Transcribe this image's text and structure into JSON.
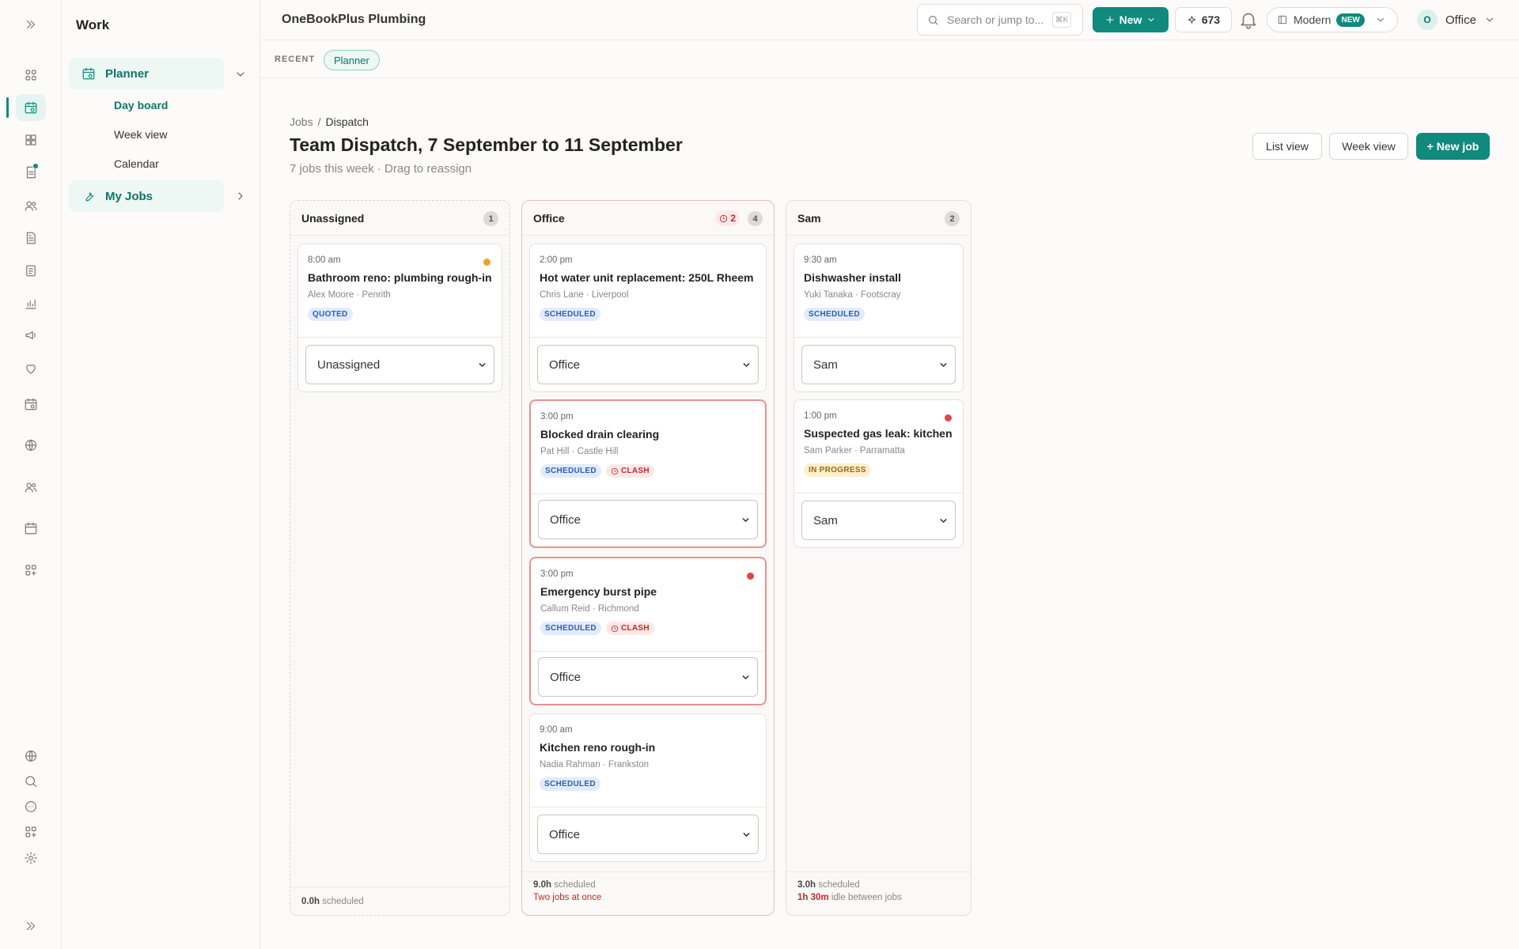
{
  "rail": {
    "items": [
      "expand-icon",
      "dashboard-icon",
      "calendar-icon",
      "grid-icon",
      "document-icon",
      "users-icon",
      "file-icon",
      "clipboard-icon",
      "chart-icon",
      "megaphone-icon",
      "heart-icon",
      "calendar-check-icon",
      "globe-icon",
      "team-icon",
      "calendar-alt-icon",
      "apps-add-icon"
    ],
    "bottom": [
      "globe-icon",
      "search-icon",
      "chat-icon",
      "apps-icon",
      "settings-icon",
      "collapse-icon"
    ]
  },
  "nav": {
    "title": "Work",
    "groups": [
      {
        "label": "Planner",
        "icon": "calendar-icon",
        "expanded": true
      },
      {
        "label": "My Jobs",
        "icon": "wrench-icon",
        "expanded": false
      }
    ],
    "planner_items": [
      "Day board",
      "Week view",
      "Calendar"
    ],
    "active_item": "Day board"
  },
  "topbar": {
    "brand": "OneBookPlus Plumbing",
    "search_placeholder": "Search or jump to...",
    "search_shortcut": "⌘K",
    "new_label": "New",
    "credits": "673",
    "theme_label": "Modern",
    "theme_badge": "NEW",
    "user_initial": "O",
    "user_label": "Office"
  },
  "recent": {
    "label": "RECENT",
    "chip": "Planner"
  },
  "page": {
    "breadcrumb": [
      "Jobs",
      "Dispatch"
    ],
    "title": "Team Dispatch, 7 September to 11 September",
    "subtitle": "7 jobs this week · Drag to reassign",
    "buttons": [
      "List view",
      "Week view",
      "+ New job"
    ]
  },
  "colors": {
    "accent": "#0f8a7c",
    "clash": "#c62828",
    "dot_orange": "#f0a024",
    "dot_red": "#e04545"
  },
  "columns": [
    {
      "name": "Unassigned",
      "count": "1",
      "foot_hours": "0.0h",
      "foot_suffix": "scheduled",
      "cards": [
        {
          "time": "8:00 am",
          "title": "Bathroom reno: plumbing rough-in",
          "meta": "Alex Moore · Penrith",
          "tags": [
            "QUOTED"
          ],
          "assignee": "Unassigned",
          "dot": "orange"
        }
      ]
    },
    {
      "name": "Office",
      "count": "4",
      "clash_count": "2",
      "foot_hours": "9.0h",
      "foot_suffix": "scheduled",
      "foot_alert": "Two jobs at once",
      "cards": [
        {
          "time": "2:00 pm",
          "title": "Hot water unit replacement: 250L Rheem",
          "meta": "Chris Lane · Liverpool",
          "tags": [
            "SCHEDULED"
          ],
          "assignee": "Office"
        },
        {
          "time": "3:00 pm",
          "title": "Blocked drain clearing",
          "meta": "Pat Hill · Castle Hill",
          "tags": [
            "SCHEDULED"
          ],
          "clash_tag": "CLASH",
          "assignee": "Office"
        },
        {
          "time": "3:00 pm",
          "title": "Emergency burst pipe",
          "meta": "Callum Reid · Richmond",
          "tags": [
            "SCHEDULED"
          ],
          "clash_tag": "CLASH",
          "assignee": "Office",
          "dot": "red"
        },
        {
          "time": "9:00 am",
          "title": "Kitchen reno rough-in",
          "meta": "Nadia Rahman · Frankston",
          "tags": [
            "SCHEDULED"
          ],
          "assignee": "Office"
        }
      ]
    },
    {
      "name": "Sam",
      "count": "2",
      "foot_hours": "3.0h",
      "foot_suffix": "scheduled",
      "foot_alert_hours": "1h 30m",
      "foot_alert_suffix": "idle between jobs",
      "cards": [
        {
          "time": "9:30 am",
          "title": "Dishwasher install",
          "meta": "Yuki Tanaka · Footscray",
          "tags": [
            "SCHEDULED"
          ],
          "assignee": "Sam"
        },
        {
          "time": "1:00 pm",
          "title": "Suspected gas leak: kitchen",
          "meta": "Sam Parker · Parramatta",
          "tags": [
            "IN PROGRESS"
          ],
          "assignee": "Sam",
          "dot": "red"
        }
      ]
    }
  ]
}
